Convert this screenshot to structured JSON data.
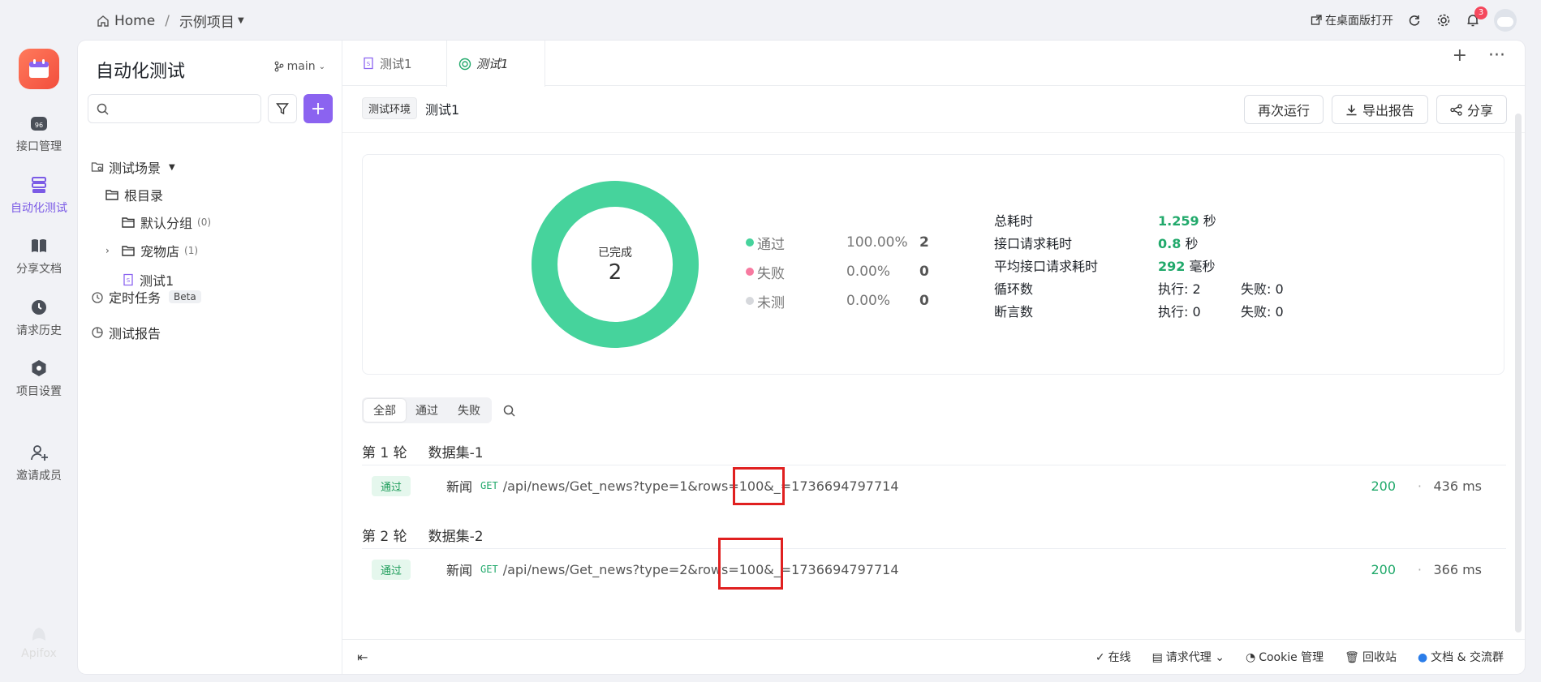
{
  "topbar": {
    "home": "Home",
    "project": "示例项目",
    "open_desktop": "在桌面版打开",
    "notif_count": "3"
  },
  "rail": {
    "items": [
      {
        "label": "接口管理"
      },
      {
        "label": "自动化测试"
      },
      {
        "label": "分享文档"
      },
      {
        "label": "请求历史"
      },
      {
        "label": "项目设置"
      },
      {
        "label": "邀请成员"
      }
    ],
    "brand": "Apifox"
  },
  "sidebar": {
    "title": "自动化测试",
    "branch": "main",
    "search_placeholder": "",
    "tree": {
      "scenes": "测试场景",
      "root": "根目录",
      "default_group": "默认分组",
      "default_count": "(0)",
      "pet_store": "宠物店",
      "pet_count": "(1)",
      "test1": "测试1",
      "scheduled": "定时任务",
      "beta": "Beta",
      "reports": "测试报告"
    }
  },
  "tabs": [
    {
      "label": "测试1"
    },
    {
      "label": "测试1"
    }
  ],
  "env": {
    "tag": "测试环境",
    "name": "测试1"
  },
  "actions": {
    "rerun": "再次运行",
    "export": "导出报告",
    "share": "分享"
  },
  "summary": {
    "done_label": "已完成",
    "done_count": "2",
    "legend": [
      {
        "name": "通过",
        "pct": "100.00%",
        "val": "2",
        "color": "#46d39c"
      },
      {
        "name": "失败",
        "pct": "0.00%",
        "val": "0",
        "color": "#f77aa0"
      },
      {
        "name": "未测",
        "pct": "0.00%",
        "val": "0",
        "color": "#d6d8dc"
      }
    ],
    "stats": {
      "total_label": "总耗时",
      "total_val": "1.259",
      "total_unit": "秒",
      "req_label": "接口请求耗时",
      "req_val": "0.8",
      "req_unit": "秒",
      "avg_label": "平均接口请求耗时",
      "avg_val": "292",
      "avg_unit": "毫秒",
      "loop_label": "循环数",
      "loop_exec": "执行: 2",
      "loop_fail": "失败: 0",
      "assert_label": "断言数",
      "assert_exec": "执行: 0",
      "assert_fail": "失败: 0"
    },
    "donut_pass_fraction": 1.0
  },
  "filters": {
    "all": "全部",
    "pass": "通过",
    "fail": "失败"
  },
  "rounds": [
    {
      "round": "第 1 轮",
      "dataset": "数据集-1",
      "tag": "通过",
      "name": "新闻",
      "method": "GET",
      "path": "/api/news/Get_news?type=1&rows=100&_=1736694797714",
      "status": "200",
      "time": "436 ms"
    },
    {
      "round": "第 2 轮",
      "dataset": "数据集-2",
      "tag": "通过",
      "name": "新闻",
      "method": "GET",
      "path": "/api/news/Get_news?type=2&rows=100&_=1736694797714",
      "status": "200",
      "time": "366 ms"
    }
  ],
  "bottombar": {
    "online": "在线",
    "proxy": "请求代理",
    "cookie": "Cookie 管理",
    "recycle": "回收站",
    "docs": "文档 & 交流群"
  }
}
